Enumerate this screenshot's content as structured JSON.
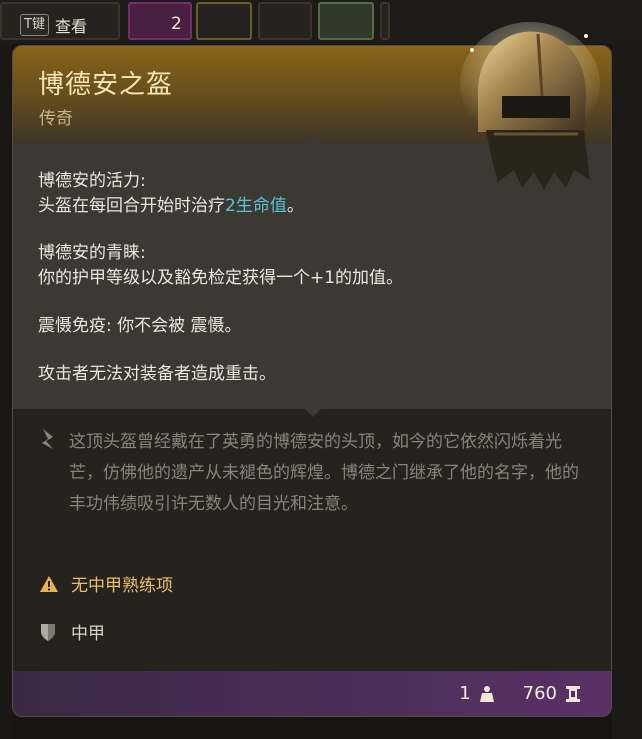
{
  "inventory": {
    "key_hint": {
      "key": "T键",
      "label": "查看"
    },
    "slot_count": "2"
  },
  "tooltip": {
    "title": "博德安之盔",
    "rarity": "传奇",
    "effects": [
      {
        "name": "博德安的活力:",
        "desc_before": "头盔在每回合开始时治疗",
        "highlight": "2生命值",
        "desc_after": "。"
      },
      {
        "name": "博德安的青睐:",
        "desc": "你的护甲等级以及豁免检定获得一个+1的加值。"
      },
      {
        "line": "震慑免疫: 你不会被 震慑。"
      },
      {
        "line": "攻击者无法对装备者造成重击。"
      }
    ],
    "lore": "这顶头盔曾经戴在了英勇的博德安的头顶，如今的它依然闪烁着光芒，仿佛他的遗产从未褪色的辉煌。博德之门继承了他的名字，他的丰功伟绩吸引许无数人的目光和注意。",
    "proficiency_warning": "无中甲熟练项",
    "armor_type": "中甲",
    "weight": "1",
    "value": "760",
    "colors": {
      "highlight": "#57c5d1",
      "warning": "#e9c065",
      "rarity": "#c9b489"
    },
    "icons": [
      "helmet-icon",
      "quill-icon",
      "warning-icon",
      "shield-icon",
      "weight-icon",
      "gold-icon"
    ]
  }
}
